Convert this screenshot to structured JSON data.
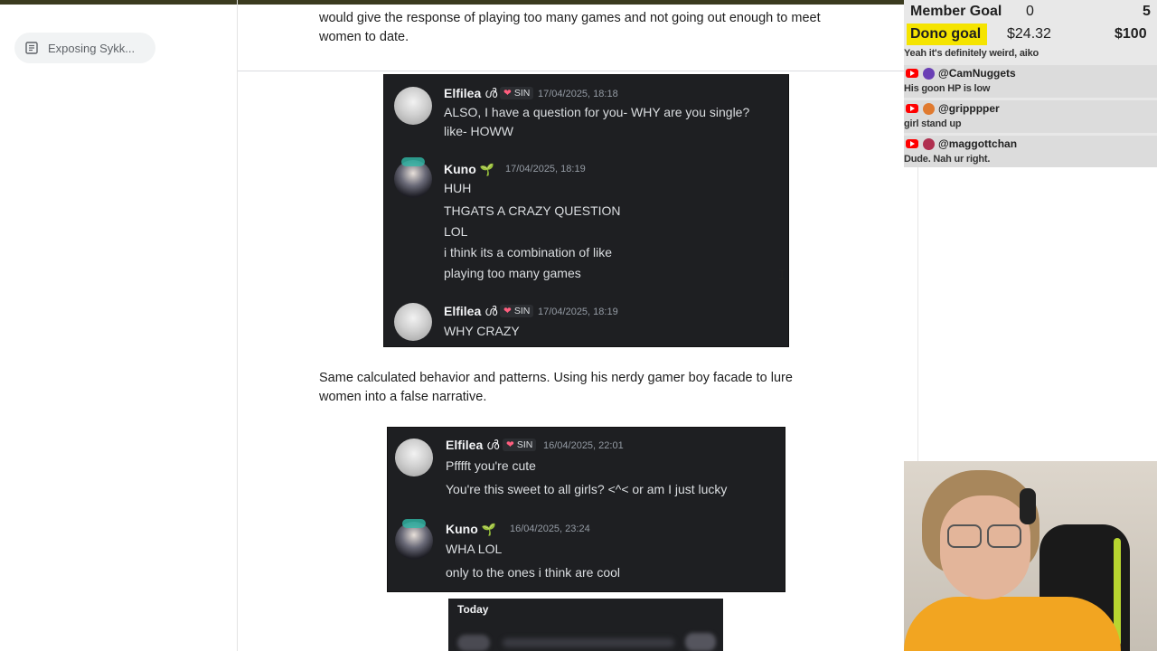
{
  "sidebar": {
    "outline_item": "Exposing Sykk..."
  },
  "document": {
    "para_top": {
      "line1": "would give the response of playing too many games and not going out enough to meet",
      "line2": "women to date."
    },
    "para_middle": {
      "line1": "Same calculated behavior and patterns. Using his nerdy gamer boy facade to lure",
      "line2": "women into a false narrative."
    }
  },
  "screenshot1": {
    "messages": [
      {
        "user": "Elfilea",
        "user_suffix": "ൾ",
        "badge": "SIN",
        "time": "17/04/2025, 18:18",
        "lines": [
          "ALSO, I have a question for you- WHY are you single?",
          "like- HOWW"
        ]
      },
      {
        "user": "Kuno",
        "time": "17/04/2025, 18:19",
        "lines": [
          "HUH",
          "THGATS A CRAZY QUESTION",
          "LOL",
          "i think its a combination of like",
          "playing too many games"
        ]
      },
      {
        "user": "Elfilea",
        "user_suffix": "ൾ",
        "badge": "SIN",
        "time": "17/04/2025, 18:19",
        "lines": [
          "WHY CRAZY"
        ]
      }
    ]
  },
  "screenshot2": {
    "messages": [
      {
        "user": "Elfilea",
        "user_suffix": "ൾ",
        "badge": "SIN",
        "time": "16/04/2025, 22:01",
        "lines": [
          "Pfffft you're cute",
          "You're this sweet to all girls? <^< or am I just lucky"
        ]
      },
      {
        "user": "Kuno",
        "time": "16/04/2025, 23:24",
        "lines": [
          "WHA LOL",
          "only to the ones i think are cool"
        ]
      }
    ]
  },
  "screenshot3": {
    "header": "Today"
  },
  "stream": {
    "member_goal": {
      "label": "Member Goal",
      "current": "0",
      "target": "5"
    },
    "dono_goal": {
      "label": "Dono goal",
      "current": "$24.32",
      "target": "$100"
    },
    "chat": {
      "first_line": "Yeah it's definitely weird, aiko",
      "messages": [
        {
          "author": "@CamNuggets",
          "text": "His goon HP is low",
          "pfp_color": "#6a3fb5"
        },
        {
          "author": "@gripppper",
          "text": "girl stand up",
          "pfp_color": "#e07a2f"
        },
        {
          "author": "@maggottchan",
          "text": "Dude. Nah ur right.",
          "pfp_color": "#b03050"
        }
      ]
    }
  }
}
